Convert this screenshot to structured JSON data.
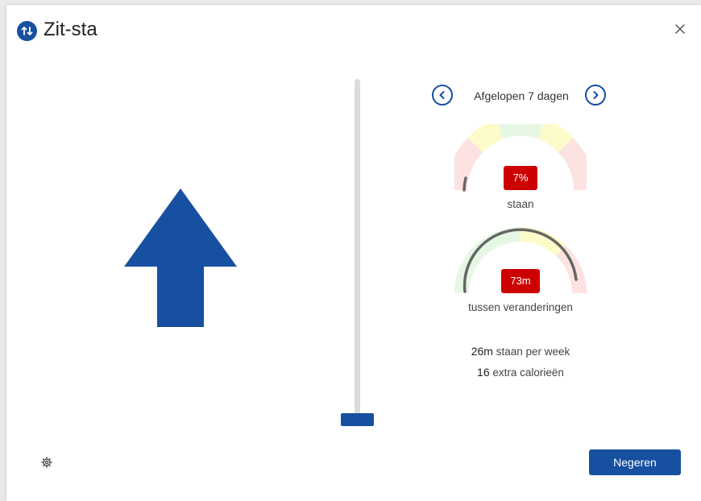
{
  "app": {
    "title": "Zit-sta",
    "icon": "sit-stand-arrows-icon"
  },
  "colors": {
    "primary": "#1750a0",
    "alert": "#cc0000",
    "zone_red": "#fde2e2",
    "zone_yellow": "#fdfbc9",
    "zone_green": "#e6f8e4",
    "needle": "#666666",
    "track": "#dcdcdc"
  },
  "indicator": {
    "direction": "up",
    "icon": "up-arrow-icon"
  },
  "slider": {
    "level": 0
  },
  "period": {
    "label": "Afgelopen 7 dagen",
    "prev_icon": "chevron-left-icon",
    "next_icon": "chevron-right-icon"
  },
  "gauges": {
    "standing": {
      "badge": "7%",
      "label": "staan",
      "value_fraction": 0.07
    },
    "between_changes": {
      "badge": "73m",
      "label": "tussen veranderingen",
      "value_fraction": 0.9
    }
  },
  "stats": {
    "standing_per_week": {
      "value": "26m",
      "label": "staan per week"
    },
    "extra_calories": {
      "value": "16",
      "label": "extra calorieën"
    }
  },
  "footer": {
    "ignore_label": "Negeren",
    "settings_icon": "gear-icon"
  }
}
